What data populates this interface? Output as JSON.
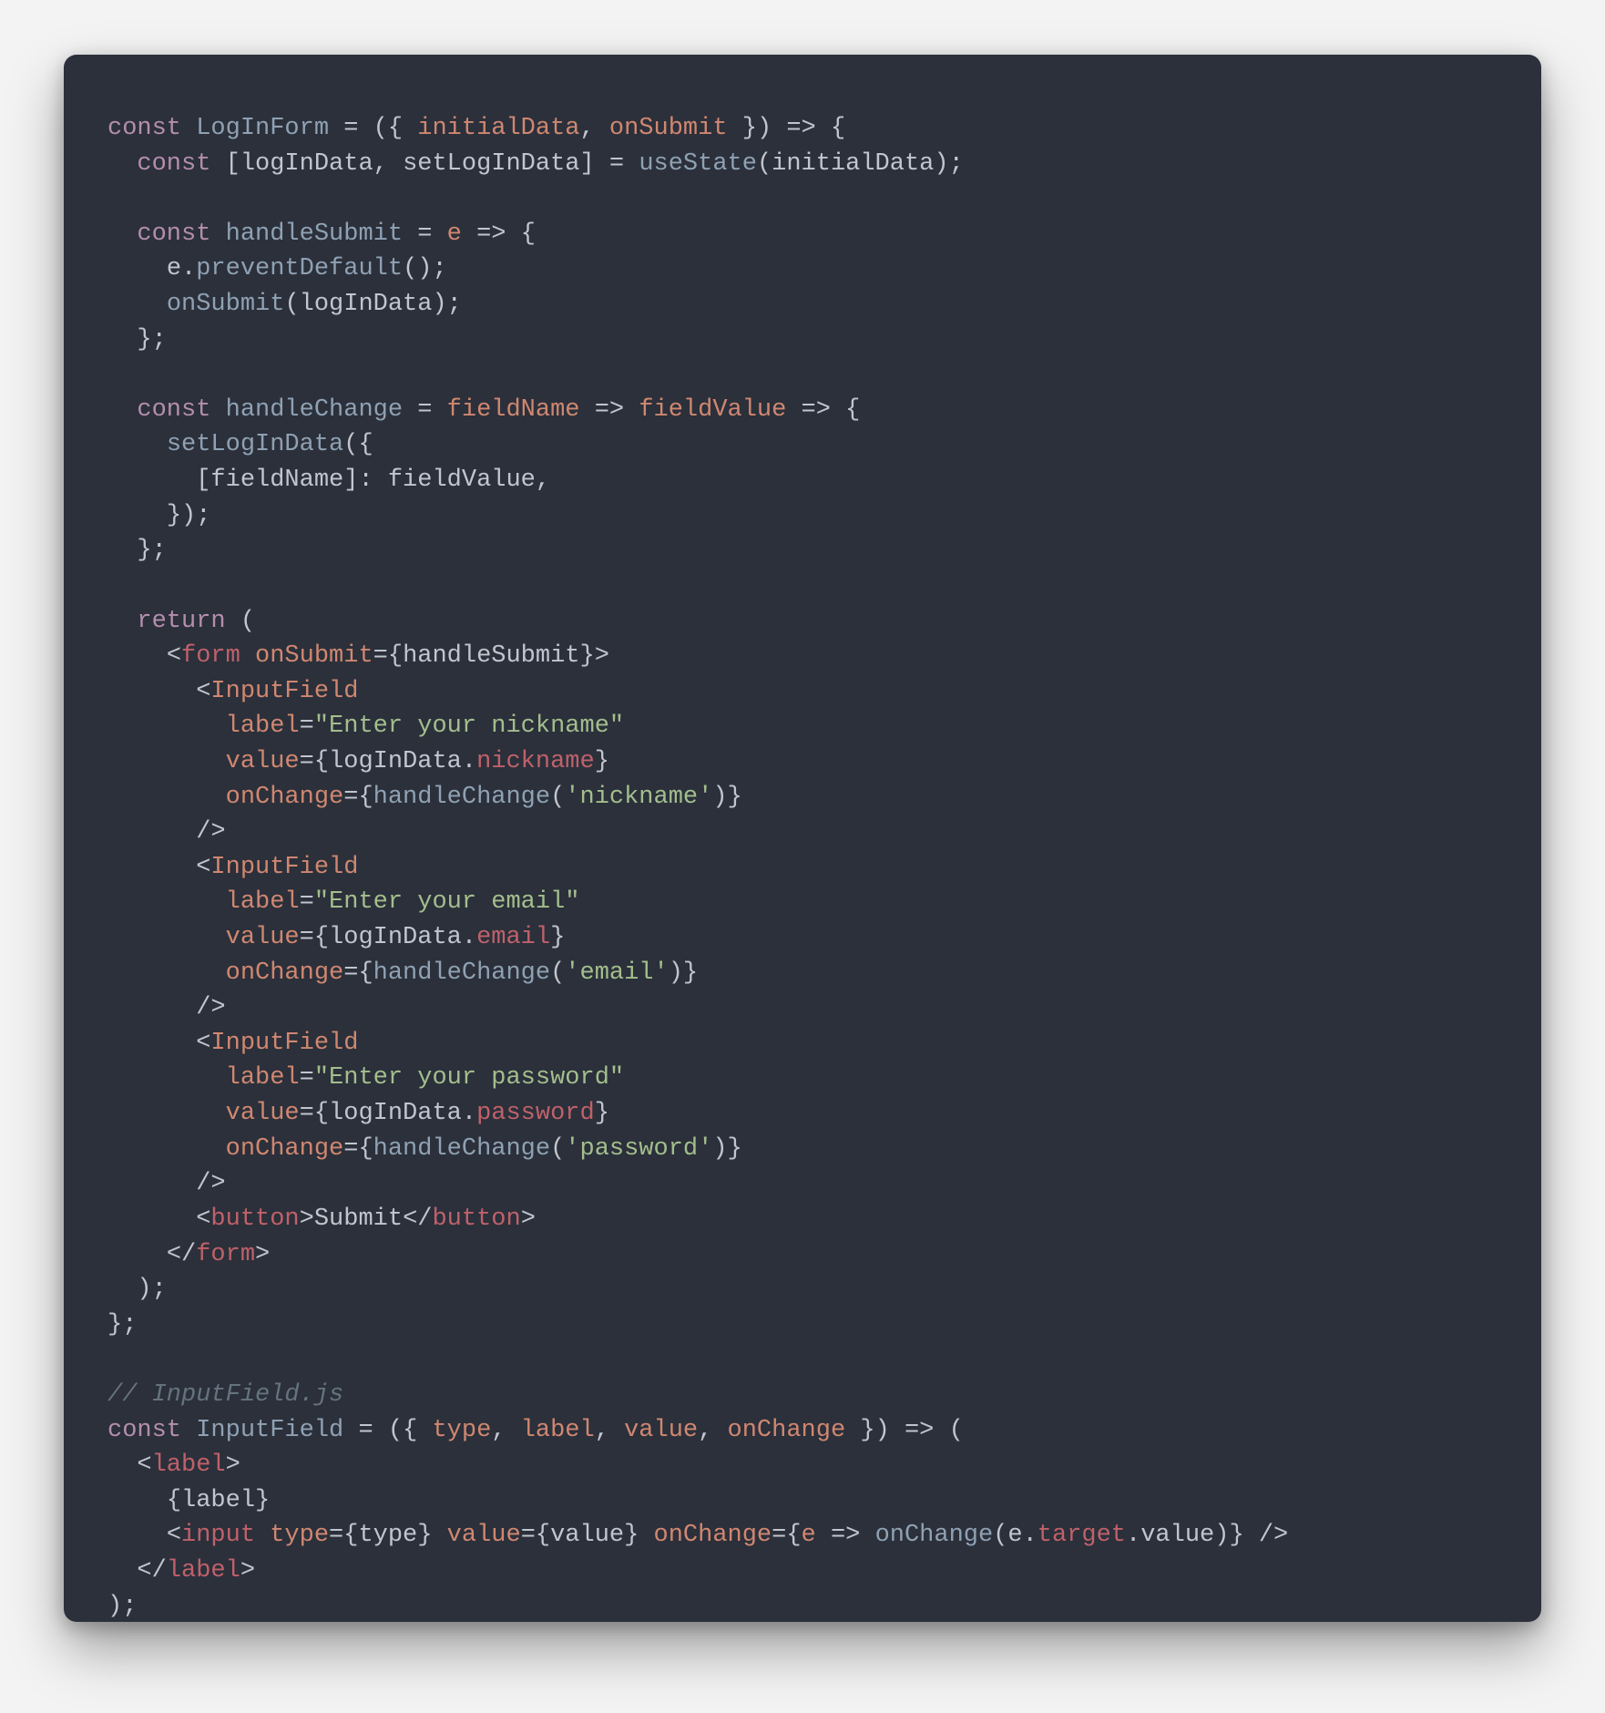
{
  "code": {
    "language": "jsx",
    "theme": "one-dark",
    "l1": {
      "kw": "const",
      "sp": " ",
      "name": "LogInForm",
      "eq": " = ",
      "po": "(",
      "ob": "{ ",
      "p1": "initialData",
      "cm": ", ",
      "p2": "onSubmit",
      "cb": " }",
      "pc": ")",
      "ar": " => ",
      "oc": "{"
    },
    "l2": {
      "ind": "  ",
      "kw": "const",
      "sp": " ",
      "ob": "[",
      "v1": "logInData",
      "cm": ", ",
      "v2": "setLogInData",
      "cb": "]",
      "eq": " = ",
      "fn": "useState",
      "po": "(",
      "arg": "initialData",
      "pc": ")",
      "sc": ";"
    },
    "l4": {
      "ind": "  ",
      "kw": "const",
      "sp": " ",
      "name": "handleSubmit",
      "eq": " = ",
      "p": "e",
      "ar": " => ",
      "oc": "{"
    },
    "l5": {
      "ind": "    ",
      "obj": "e",
      "dot": ".",
      "m": "preventDefault",
      "po": "(",
      "pc": ")",
      "sc": ";"
    },
    "l6": {
      "ind": "    ",
      "fn": "onSubmit",
      "po": "(",
      "arg": "logInData",
      "pc": ")",
      "sc": ";"
    },
    "l7": {
      "ind": "  ",
      "cc": "}",
      "sc": ";"
    },
    "l9": {
      "ind": "  ",
      "kw": "const",
      "sp": " ",
      "name": "handleChange",
      "eq": " = ",
      "p1": "fieldName",
      "ar1": " => ",
      "p2": "fieldValue",
      "ar2": " => ",
      "oc": "{"
    },
    "l10": {
      "ind": "    ",
      "fn": "setLogInData",
      "po": "(",
      "ob": "{"
    },
    "l11": {
      "ind": "      ",
      "ob": "[",
      "k": "fieldName",
      "cb": "]",
      "col": ": ",
      "v": "fieldValue",
      "cm": ","
    },
    "l12": {
      "ind": "    ",
      "cb": "}",
      "pc": ")",
      "sc": ";"
    },
    "l13": {
      "ind": "  ",
      "cc": "}",
      "sc": ";"
    },
    "l15": {
      "ind": "  ",
      "kw": "return",
      "sp": " ",
      "po": "("
    },
    "l16": {
      "ind": "    ",
      "lt": "<",
      "tag": "form",
      "sp": " ",
      "attr": "onSubmit",
      "eq": "=",
      "ob": "{",
      "val": "handleSubmit",
      "cb": "}",
      "gt": ">"
    },
    "l17": {
      "ind": "      ",
      "lt": "<",
      "tag": "InputField"
    },
    "l18": {
      "ind": "        ",
      "attr": "label",
      "eq": "=",
      "str": "\"Enter your nickname\""
    },
    "l19": {
      "ind": "        ",
      "attr": "value",
      "eq": "=",
      "ob": "{",
      "o": "logInData",
      "dot": ".",
      "p": "nickname",
      "cb": "}"
    },
    "l20": {
      "ind": "        ",
      "attr": "onChange",
      "eq": "=",
      "ob": "{",
      "fn": "handleChange",
      "po": "(",
      "str": "'nickname'",
      "pc": ")",
      "cb": "}"
    },
    "l21": {
      "ind": "      ",
      "sc": "/>"
    },
    "l22": {
      "ind": "      ",
      "lt": "<",
      "tag": "InputField"
    },
    "l23": {
      "ind": "        ",
      "attr": "label",
      "eq": "=",
      "str": "\"Enter your email\""
    },
    "l24": {
      "ind": "        ",
      "attr": "value",
      "eq": "=",
      "ob": "{",
      "o": "logInData",
      "dot": ".",
      "p": "email",
      "cb": "}"
    },
    "l25": {
      "ind": "        ",
      "attr": "onChange",
      "eq": "=",
      "ob": "{",
      "fn": "handleChange",
      "po": "(",
      "str": "'email'",
      "pc": ")",
      "cb": "}"
    },
    "l26": {
      "ind": "      ",
      "sc": "/>"
    },
    "l27": {
      "ind": "      ",
      "lt": "<",
      "tag": "InputField"
    },
    "l28": {
      "ind": "        ",
      "attr": "label",
      "eq": "=",
      "str": "\"Enter your password\""
    },
    "l29": {
      "ind": "        ",
      "attr": "value",
      "eq": "=",
      "ob": "{",
      "o": "logInData",
      "dot": ".",
      "p": "password",
      "cb": "}"
    },
    "l30": {
      "ind": "        ",
      "attr": "onChange",
      "eq": "=",
      "ob": "{",
      "fn": "handleChange",
      "po": "(",
      "str": "'password'",
      "pc": ")",
      "cb": "}"
    },
    "l31": {
      "ind": "      ",
      "sc": "/>"
    },
    "l32": {
      "ind": "      ",
      "lt": "<",
      "tag": "button",
      "gt": ">",
      "txt": "Submit",
      "lt2": "</",
      "tag2": "button",
      "gt2": ">"
    },
    "l33": {
      "ind": "    ",
      "lt": "</",
      "tag": "form",
      "gt": ">"
    },
    "l34": {
      "ind": "  ",
      "pc": ")",
      "sc": ";"
    },
    "l35": {
      "cc": "}",
      "sc": ";"
    },
    "l37": {
      "cmt": "// InputField.js"
    },
    "l38": {
      "kw": "const",
      "sp": " ",
      "name": "InputField",
      "eq": " = ",
      "po": "(",
      "ob": "{ ",
      "p1": "type",
      "c1": ", ",
      "p2": "label",
      "c2": ", ",
      "p3": "value",
      "c3": ", ",
      "p4": "onChange",
      "cb": " }",
      "pc": ")",
      "ar": " => ",
      "po2": "("
    },
    "l39": {
      "ind": "  ",
      "lt": "<",
      "tag": "label",
      "gt": ">"
    },
    "l40": {
      "ind": "    ",
      "ob": "{",
      "v": "label",
      "cb": "}"
    },
    "l41": {
      "ind": "    ",
      "lt": "<",
      "tag": "input",
      "sp": " ",
      "a1": "type",
      "e1": "=",
      "o1": "{",
      "v1": "type",
      "c1": "}",
      "sp2": " ",
      "a2": "value",
      "e2": "=",
      "o2": "{",
      "v2": "value",
      "c2": "}",
      "sp3": " ",
      "a3": "onChange",
      "e3": "=",
      "o3": "{",
      "p": "e",
      "ar": " => ",
      "fn": "onChange",
      "po": "(",
      "vo": "e",
      "d1": ".",
      "vp1": "target",
      "d2": ".",
      "vp2": "value",
      "pc": ")",
      "c3": "}",
      "sp4": " ",
      "sc": "/>"
    },
    "l42": {
      "ind": "  ",
      "lt": "</",
      "tag": "label",
      "gt": ">"
    },
    "l43": {
      "pc": ")",
      "sc": ";"
    }
  }
}
